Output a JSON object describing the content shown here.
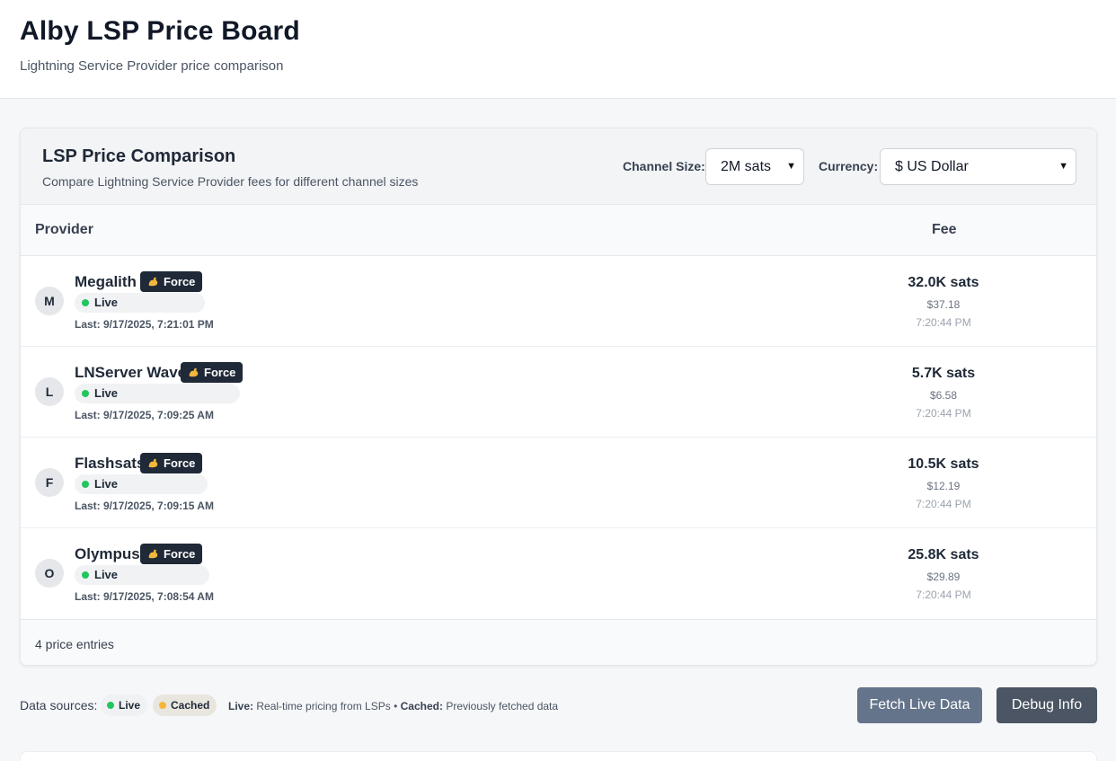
{
  "header": {
    "title": "Alby LSP Price Board",
    "subtitle": "Lightning Service Provider price comparison"
  },
  "card": {
    "title": "LSP Price Comparison",
    "description": "Compare Lightning Service Provider fees for different channel sizes",
    "channel_size_label": "Channel Size:",
    "channel_size_value": "2M sats",
    "currency_label": "Currency:",
    "currency_value": "$ US Dollar",
    "columns": {
      "provider": "Provider",
      "fee": "Fee"
    },
    "footer_count": "4 price entries"
  },
  "providers": [
    {
      "initial": "M",
      "name": "Megalith",
      "force_label": "Force",
      "status": "Live",
      "last": "Last: 9/17/2025, 7:21:01 PM",
      "sats": "32.0K sats",
      "usd": "$37.18",
      "time": "7:20:44 PM"
    },
    {
      "initial": "L",
      "name": "LNServer Wave",
      "force_label": "Force",
      "status": "Live",
      "last": "Last: 9/17/2025, 7:09:25 AM",
      "sats": "5.7K sats",
      "usd": "$6.58",
      "time": "7:20:44 PM"
    },
    {
      "initial": "F",
      "name": "Flashsats",
      "force_label": "Force",
      "status": "Live",
      "last": "Last: 9/17/2025, 7:09:15 AM",
      "sats": "10.5K sats",
      "usd": "$12.19",
      "time": "7:20:44 PM"
    },
    {
      "initial": "O",
      "name": "Olympus",
      "force_label": "Force",
      "status": "Live",
      "last": "Last: 9/17/2025, 7:08:54 AM",
      "sats": "25.8K sats",
      "usd": "$29.89",
      "time": "7:20:44 PM"
    }
  ],
  "footer": {
    "sources_label": "Data sources:",
    "live_pill": "Live",
    "cached_pill": "Cached",
    "live_key": "Live:",
    "live_desc": "Real-time pricing from LSPs •",
    "cached_key": "Cached:",
    "cached_desc": "Previously fetched data",
    "fetch_button": "Fetch Live Data",
    "debug_button": "Debug Info"
  },
  "colors": {
    "live_dot": "#22c55e",
    "cached_dot": "#f5b73b",
    "badge_bg": "#1f2937",
    "fetch_bg": "#64748b",
    "debug_bg": "#4b5563"
  },
  "icons": {
    "force": "flexed-biceps-icon",
    "select_caret": "chevron-down-icon",
    "status_live": "green-dot-icon",
    "status_cached": "yellow-dot-icon"
  }
}
